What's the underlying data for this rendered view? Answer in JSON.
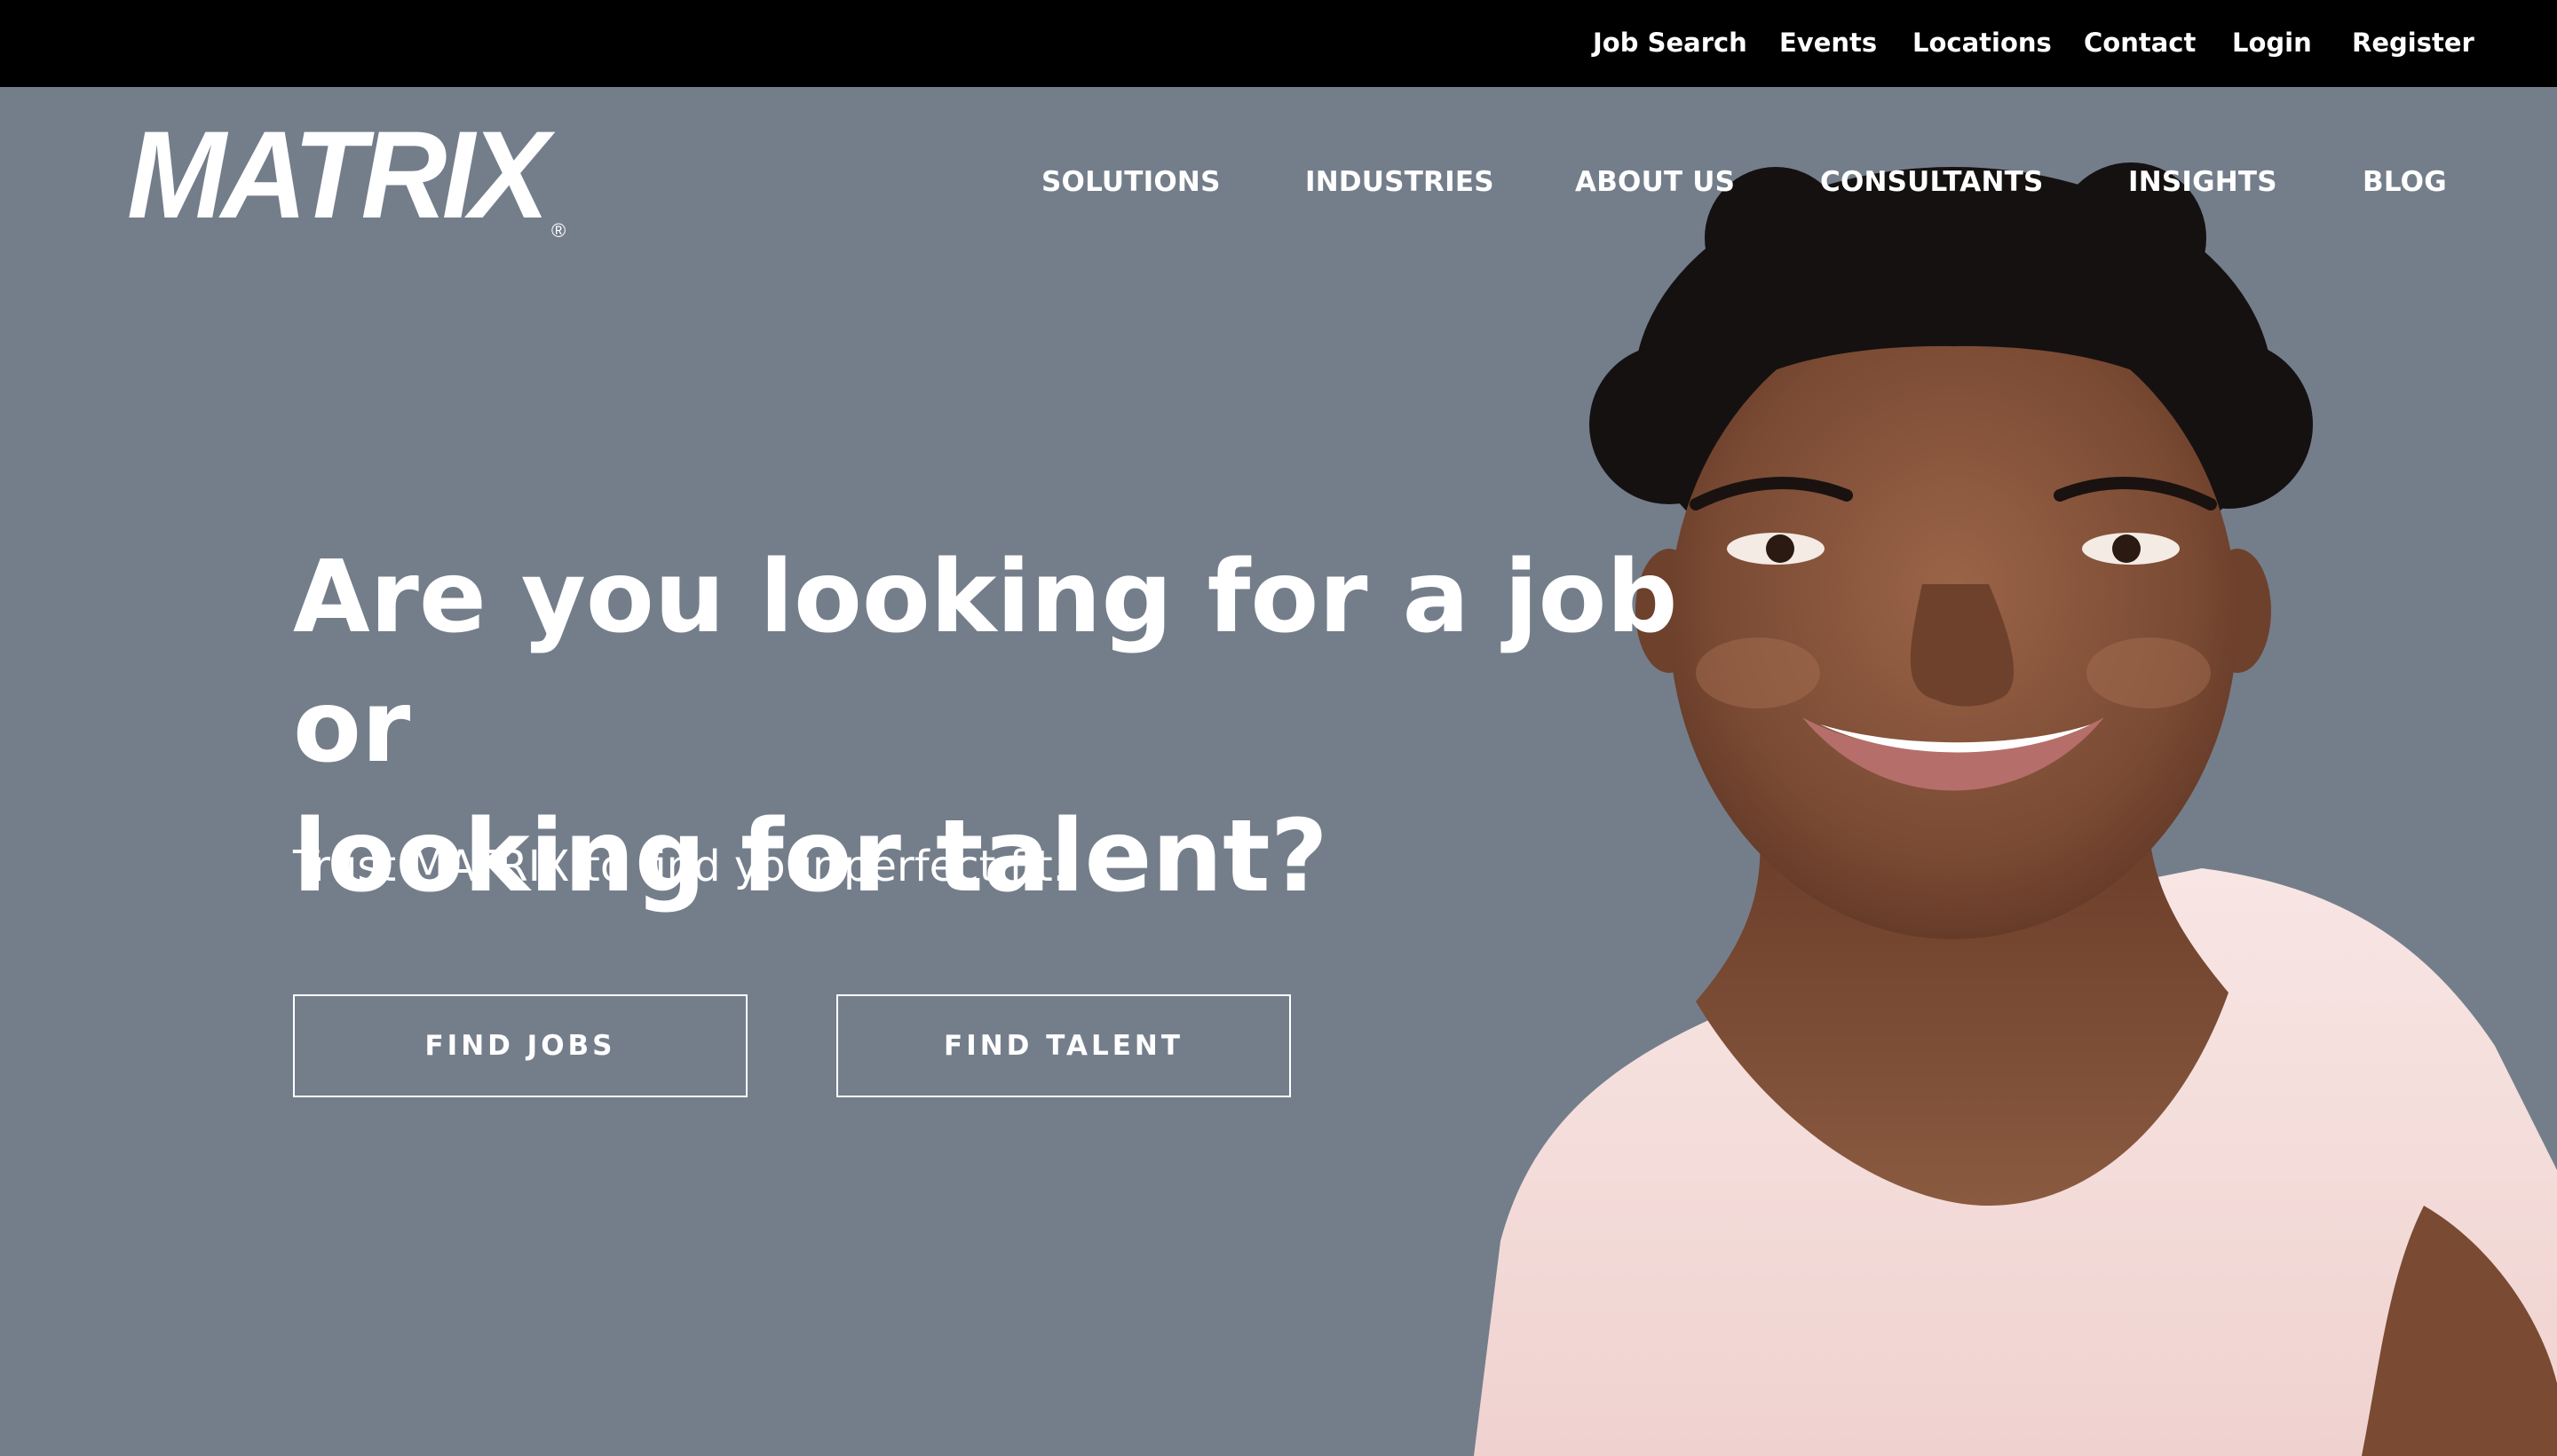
{
  "topbar": {
    "links": [
      "Job Search",
      "Events",
      "Locations",
      "Contact",
      "Login",
      "Register"
    ]
  },
  "logo": {
    "text": "MATRIX",
    "mark": "®",
    "color": "#ffffff"
  },
  "main_nav": {
    "items": [
      "SOLUTIONS",
      "INDUSTRIES",
      "ABOUT US",
      "CONSULTANTS",
      "INSIGHTS",
      "BLOG"
    ]
  },
  "hero": {
    "headline_line1": "Are you looking for a job or",
    "headline_line2": "looking for talent?",
    "subheadline": "Trust MATRIX to find your perfect fit.",
    "find_jobs_label": "FIND JOBS",
    "find_talent_label": "FIND TALENT",
    "background_color": "#747e8b",
    "photo": "smiling-woman-photo"
  },
  "colors": {
    "topbar_bg": "#000000",
    "text": "#ffffff",
    "hero_bg": "#747e8b"
  }
}
